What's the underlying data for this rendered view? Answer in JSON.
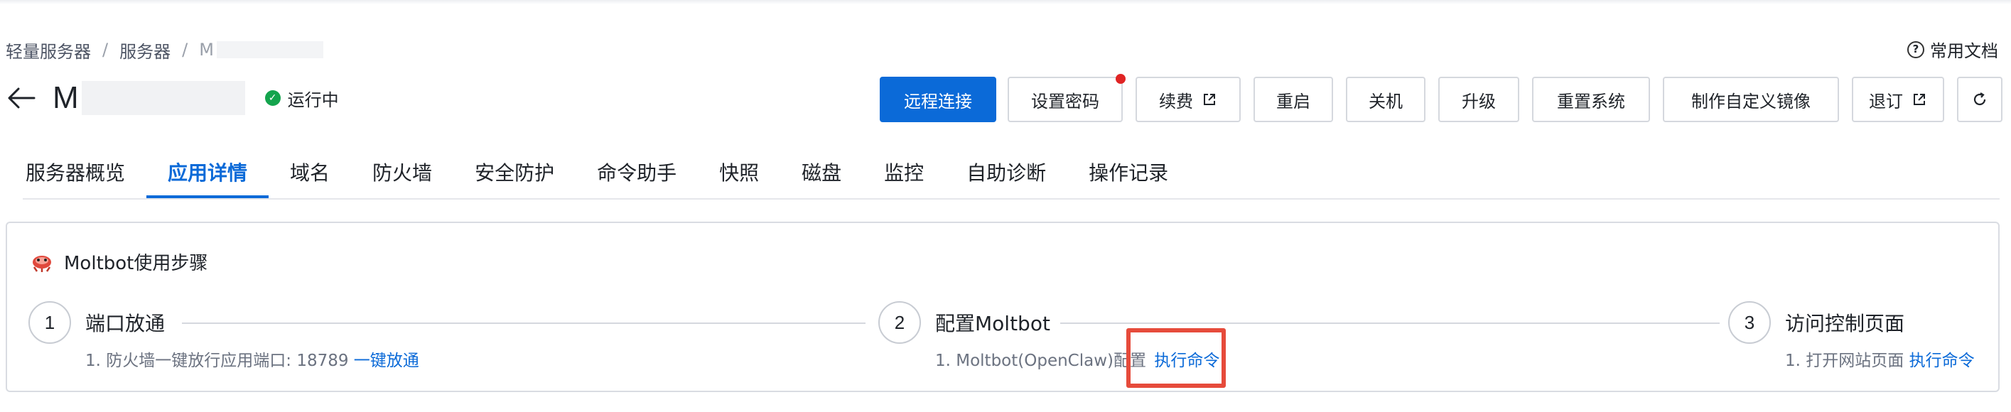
{
  "breadcrumb": {
    "items": [
      "轻量服务器",
      "服务器",
      "M"
    ]
  },
  "help": {
    "doc_label": "常用文档"
  },
  "header": {
    "server_name": "M",
    "status": "运行中",
    "status_color": "#14a44d"
  },
  "actions": {
    "remote_connect": "远程连接",
    "set_password": "设置密码",
    "renew": "续费",
    "restart": "重启",
    "shutdown": "关机",
    "upgrade": "升级",
    "reinstall": "重置系统",
    "make_image": "制作自定义镜像",
    "unsubscribe": "退订"
  },
  "tabs": [
    "服务器概览",
    "应用详情",
    "域名",
    "防火墙",
    "安全防护",
    "命令助手",
    "快照",
    "磁盘",
    "监控",
    "自助诊断",
    "操作记录"
  ],
  "active_tab": "应用详情",
  "card": {
    "title": "Moltbot使用步骤",
    "steps": [
      {
        "num": "1",
        "title": "端口放通",
        "desc": "1. 防火墙一键放行应用端口: 18789",
        "link": "一键放通"
      },
      {
        "num": "2",
        "title": "配置Moltbot",
        "desc": "1. Moltbot(OpenClaw)配置",
        "link": "执行命令"
      },
      {
        "num": "3",
        "title": "访问控制页面",
        "desc": "1. 打开网站页面",
        "link": "执行命令"
      }
    ]
  },
  "colors": {
    "primary": "#0b6ad8",
    "highlight_box": "#e64b3b",
    "notification_dot": "#e02424"
  }
}
